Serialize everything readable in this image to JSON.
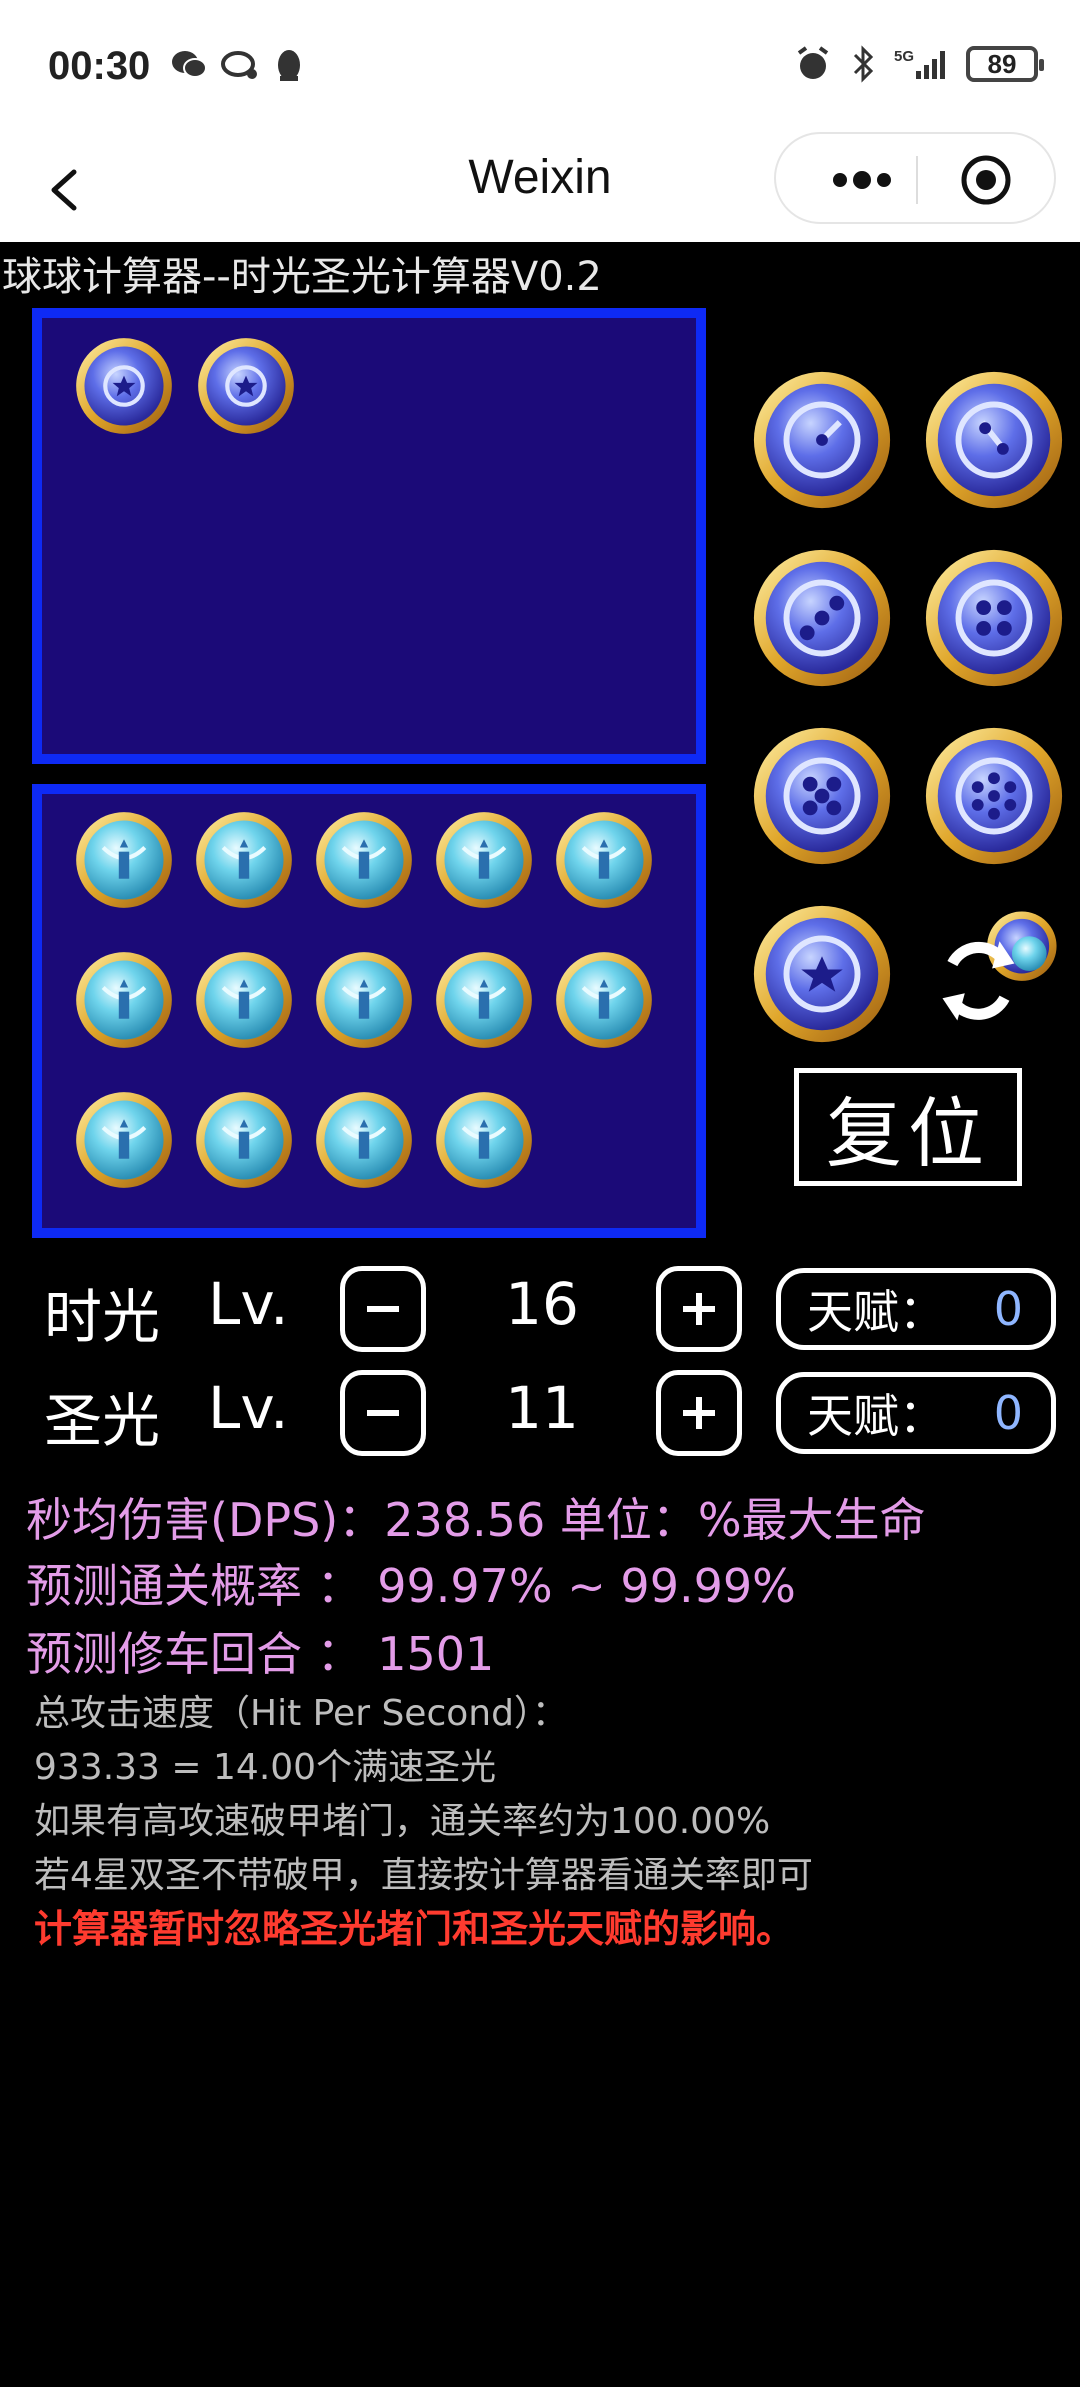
{
  "status_bar": {
    "time": "00:30",
    "battery": "89",
    "network": "5G"
  },
  "nav": {
    "title": "Weixin"
  },
  "app": {
    "title": "球球计算器--时光圣光计算器V0.2",
    "reset_label": "复位",
    "rows": [
      {
        "name": "时光",
        "lv_label": "Lv.",
        "level": "16",
        "talent_label": "天赋：",
        "talent_value": "0"
      },
      {
        "name": "圣光",
        "lv_label": "Lv.",
        "level": "11",
        "talent_label": "天赋：",
        "talent_value": "0"
      }
    ],
    "stats": {
      "dps": "秒均伤害(DPS)：238.56   单位：%最大生命",
      "clear_rate": "预测通关概率  ：  99.97% ~ 99.99%",
      "repair_round": "预测修车回合  ：  1501"
    },
    "info": {
      "speed_label": "总攻击速度（Hit Per Second）：",
      "speed_value": "933.33 = 14.00个满速圣光",
      "note1": "如果有高攻速破甲堵门，通关率约为100.00%",
      "note2": "若4星双圣不带破甲，直接按计算器看通关率即可",
      "warning": "计算器暂时忽略圣光堵门和圣光天赋的影响。"
    },
    "top_panel_orbs": [
      "time-orb-star",
      "time-orb-star"
    ],
    "bottom_panel_orb_count": 14,
    "palette": [
      "time-orb-1",
      "time-orb-2",
      "time-orb-3",
      "time-orb-4",
      "time-orb-5",
      "time-orb-7",
      "time-orb-star",
      "swap-orb"
    ],
    "colors": {
      "panel_fill": "#1b0a78",
      "panel_border": "#0e2af5",
      "stat_text": "#e39ce8",
      "warning_text": "#ff3b2f",
      "talent_value": "#8fb6ff"
    }
  }
}
